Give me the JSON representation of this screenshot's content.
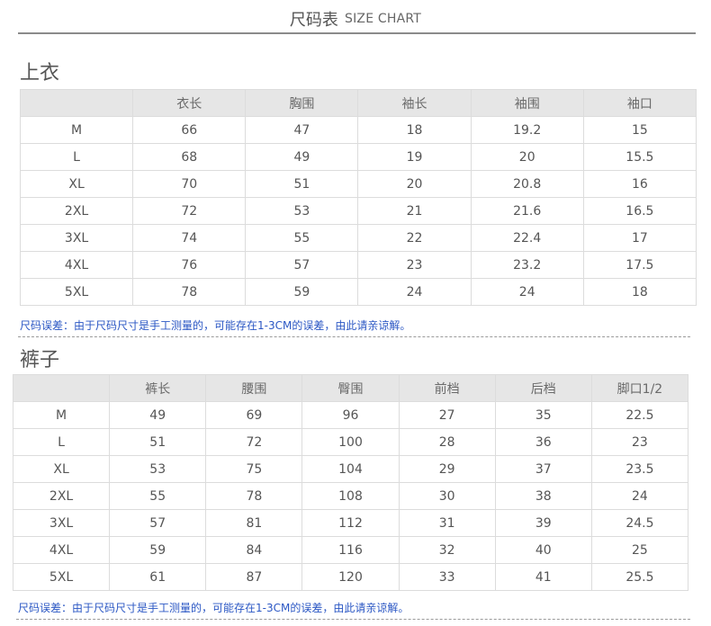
{
  "header": {
    "title_cn": "尺码表",
    "title_en": "SIZE CHART"
  },
  "top": {
    "title": "上衣",
    "columns": [
      "",
      "衣长",
      "胸围",
      "袖长",
      "袖围",
      "袖口"
    ],
    "rows": [
      [
        "M",
        "66",
        "47",
        "18",
        "19.2",
        "15"
      ],
      [
        "L",
        "68",
        "49",
        "19",
        "20",
        "15.5"
      ],
      [
        "XL",
        "70",
        "51",
        "20",
        "20.8",
        "16"
      ],
      [
        "2XL",
        "72",
        "53",
        "21",
        "21.6",
        "16.5"
      ],
      [
        "3XL",
        "74",
        "55",
        "22",
        "22.4",
        "17"
      ],
      [
        "4XL",
        "76",
        "57",
        "23",
        "23.2",
        "17.5"
      ],
      [
        "5XL",
        "78",
        "59",
        "24",
        "24",
        "18"
      ]
    ],
    "note": "尺码误差：由于尺码尺寸是手工测量的，可能存在1-3CM的误差，由此请亲谅解。"
  },
  "bottom": {
    "title": "裤子",
    "columns": [
      "",
      "裤长",
      "腰围",
      "臀围",
      "前档",
      "后档",
      "脚口1/2"
    ],
    "rows": [
      [
        "M",
        "49",
        "69",
        "96",
        "27",
        "35",
        "22.5"
      ],
      [
        "L",
        "51",
        "72",
        "100",
        "28",
        "36",
        "23"
      ],
      [
        "XL",
        "53",
        "75",
        "104",
        "29",
        "37",
        "23.5"
      ],
      [
        "2XL",
        "55",
        "78",
        "108",
        "30",
        "38",
        "24"
      ],
      [
        "3XL",
        "57",
        "81",
        "112",
        "31",
        "39",
        "24.5"
      ],
      [
        "4XL",
        "59",
        "84",
        "116",
        "32",
        "40",
        "25"
      ],
      [
        "5XL",
        "61",
        "87",
        "120",
        "33",
        "41",
        "25.5"
      ]
    ],
    "note": "尺码误差：由于尺码尺寸是手工测量的，可能存在1-3CM的误差，由此请亲谅解。"
  },
  "colors": {
    "note": "#2b57c4",
    "header_bg": "#e6e6e6",
    "border": "#dcdcdc",
    "text": "#555555"
  }
}
